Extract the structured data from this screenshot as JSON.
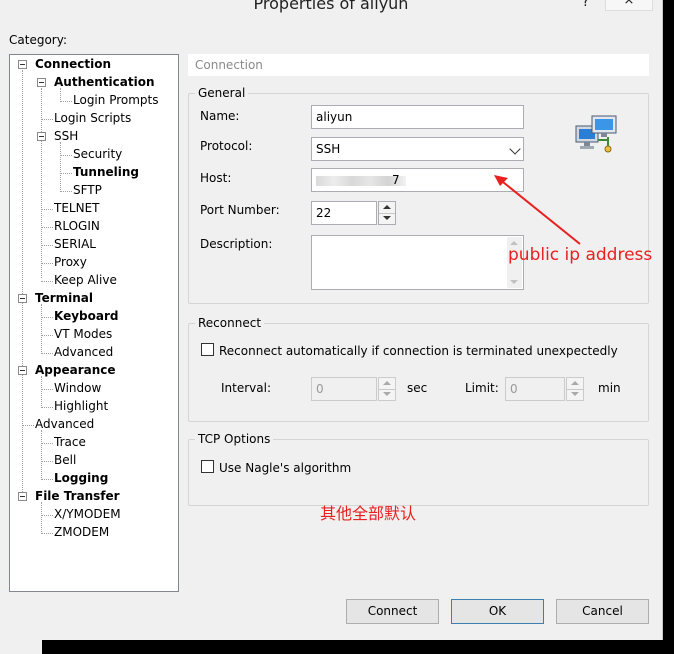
{
  "window": {
    "title": "Properties of aliyun",
    "help_label": "?",
    "close_label": "×"
  },
  "category": {
    "label": "Category:",
    "tree": [
      {
        "label": "Connection",
        "bold": true
      },
      {
        "label": "Authentication",
        "bold": true
      },
      {
        "label": "Login Prompts",
        "bold": false
      },
      {
        "label": "Login Scripts",
        "bold": false
      },
      {
        "label": "SSH",
        "bold": false
      },
      {
        "label": "Security",
        "bold": false
      },
      {
        "label": "Tunneling",
        "bold": true
      },
      {
        "label": "SFTP",
        "bold": false
      },
      {
        "label": "TELNET",
        "bold": false
      },
      {
        "label": "RLOGIN",
        "bold": false
      },
      {
        "label": "SERIAL",
        "bold": false
      },
      {
        "label": "Proxy",
        "bold": false
      },
      {
        "label": "Keep Alive",
        "bold": false
      },
      {
        "label": "Terminal",
        "bold": true
      },
      {
        "label": "Keyboard",
        "bold": true
      },
      {
        "label": "VT Modes",
        "bold": false
      },
      {
        "label": "Advanced",
        "bold": false
      },
      {
        "label": "Appearance",
        "bold": true
      },
      {
        "label": "Window",
        "bold": false
      },
      {
        "label": "Highlight",
        "bold": false
      },
      {
        "label": "Advanced",
        "bold": false
      },
      {
        "label": "Trace",
        "bold": false
      },
      {
        "label": "Bell",
        "bold": false
      },
      {
        "label": "Logging",
        "bold": true
      },
      {
        "label": "File Transfer",
        "bold": true
      },
      {
        "label": "X/YMODEM",
        "bold": false
      },
      {
        "label": "ZMODEM",
        "bold": false
      }
    ]
  },
  "panel": {
    "header": "Connection"
  },
  "general": {
    "legend": "General",
    "name_label": "Name:",
    "name_value": "aliyun",
    "protocol_label": "Protocol:",
    "protocol_value": "SSH",
    "host_label": "Host:",
    "host_value": "",
    "host_suffix": "7",
    "port_label": "Port Number:",
    "port_value": "22",
    "description_label": "Description:",
    "description_value": ""
  },
  "reconnect": {
    "legend": "Reconnect",
    "checkbox_label": "Reconnect automatically if connection is terminated unexpectedly",
    "interval_label": "Interval:",
    "interval_value": "0",
    "interval_unit": "sec",
    "limit_label": "Limit:",
    "limit_value": "0",
    "limit_unit": "min"
  },
  "tcp": {
    "legend": "TCP Options",
    "checkbox_label": "Use Nagle's algorithm"
  },
  "annotations": {
    "host_note": "public ip address",
    "bottom_note": "其他全部默认",
    "color": "#e82020"
  },
  "buttons": {
    "connect": "Connect",
    "ok": "OK",
    "cancel": "Cancel"
  },
  "icons": {
    "session": "network-computers-icon"
  }
}
